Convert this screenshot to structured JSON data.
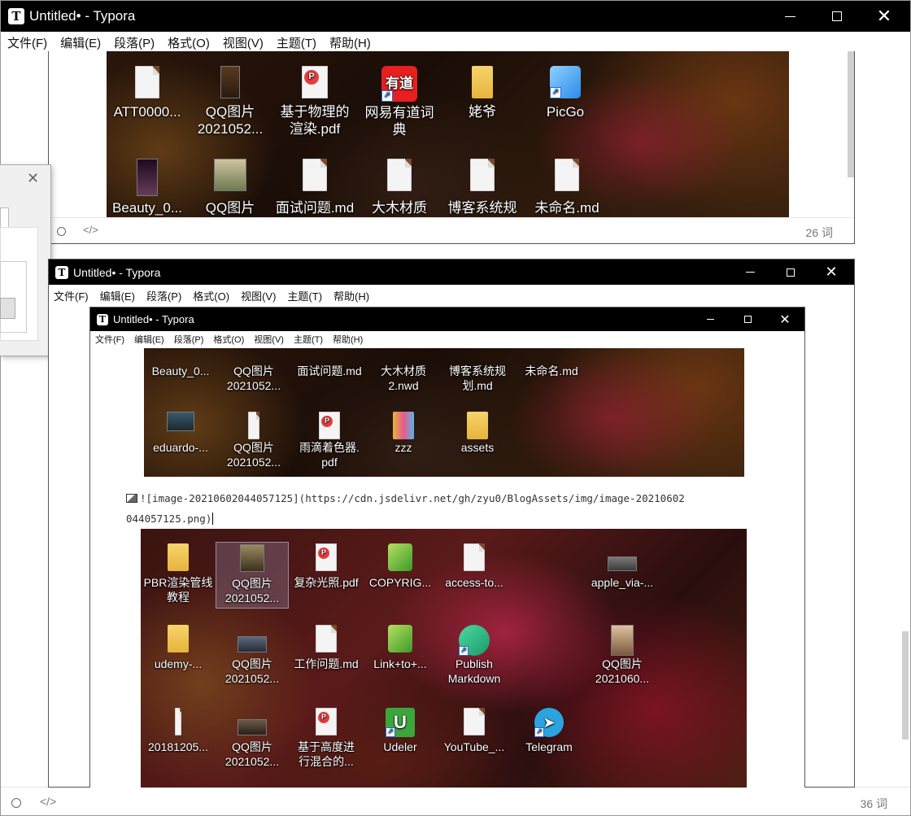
{
  "outer": {
    "title": "Untitled• - Typora",
    "menu": [
      "文件(F)",
      "编辑(E)",
      "段落(P)",
      "格式(O)",
      "视图(V)",
      "主题(T)",
      "帮助(H)"
    ],
    "word_count": "36 词"
  },
  "inner1": {
    "word_count": "26 词",
    "row1": [
      "ATT0000...",
      "QQ图片\n2021052...",
      "基于物理的\n渲染.pdf",
      "网易有道词\n典",
      "姥爷",
      "PicGo"
    ],
    "row2": [
      "Beauty_0...",
      "QQ图片",
      "面试问题.md",
      "大木材质",
      "博客系统规",
      "未命名.md"
    ],
    "youdao_text": "有道"
  },
  "inner2": {
    "title": "Untitled• - Typora",
    "menu": [
      "文件(F)",
      "编辑(E)",
      "段落(P)",
      "格式(O)",
      "视图(V)",
      "主题(T)",
      "帮助(H)"
    ]
  },
  "inner3": {
    "title": "Untitled• - Typora",
    "menu": [
      "文件(F)",
      "编辑(E)",
      "段落(P)",
      "格式(O)",
      "视图(V)",
      "主题(T)",
      "帮助(H)"
    ],
    "rowA": [
      "Beauty_0...",
      "QQ图片\n2021052...",
      "面试问题.md",
      "大木材质\n2.nwd",
      "博客系统规\n划.md",
      "未命名.md"
    ],
    "rowB": [
      "eduardo-...",
      "QQ图片\n2021052...",
      "雨滴着色器.\npdf",
      "zzz",
      "assets"
    ],
    "code_line1": "![image-20210602044057125](https://cdn.jsdelivr.net/gh/zyu0/BlogAssets/img/image-20210602",
    "code_line2": "044057125.png)",
    "rowC": [
      "PBR渲染管线\n教程",
      "QQ图片\n2021052...",
      "复杂光照.pdf",
      "COPYRIG...",
      "access-to...",
      "apple_via-..."
    ],
    "rowD": [
      "udemy-...",
      "QQ图片\n2021052...",
      "工作问题.md",
      "Link+to+...",
      "Publish\nMarkdown",
      "QQ图片\n2021060..."
    ],
    "rowE": [
      "20181205...",
      "QQ图片\n2021052...",
      "基于高度进\n行混合的...",
      "Udeler",
      "YouTube_...",
      "Telegram"
    ],
    "udeler_glyph": "U",
    "telegram_glyph": "➤"
  },
  "pdf_badge": "P",
  "icons": {
    "close": "close-icon",
    "max": "maximize-icon",
    "min": "minimize-icon"
  }
}
